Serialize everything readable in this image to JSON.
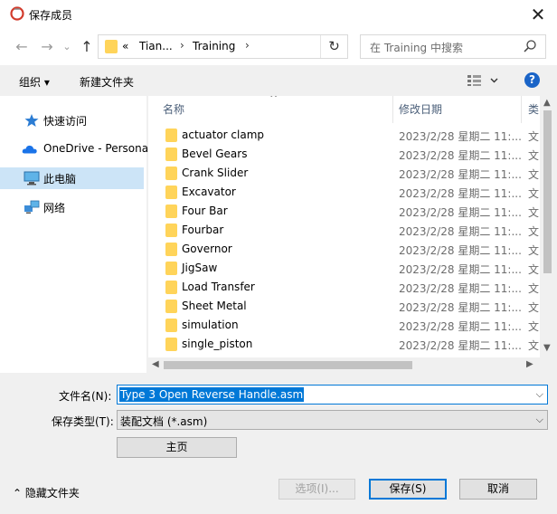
{
  "window": {
    "title": "保存成员"
  },
  "address": {
    "crumbs": [
      "«",
      "Tian...",
      "Training"
    ],
    "refresh_icon": "refresh-icon"
  },
  "search": {
    "placeholder": "在 Training 中搜索"
  },
  "toolbar": {
    "organize": "组织 ▾",
    "new_folder": "新建文件夹",
    "help": "?"
  },
  "sidebar": {
    "items": [
      {
        "label": "快速访问",
        "icon": "star-icon"
      },
      {
        "label": "OneDrive - Personal",
        "icon": "cloud-icon"
      },
      {
        "label": "此电脑",
        "icon": "computer-icon",
        "selected": true
      },
      {
        "label": "网络",
        "icon": "network-icon"
      }
    ]
  },
  "files": {
    "columns": [
      "名称",
      "修改日期",
      "类"
    ],
    "rows": [
      {
        "name": "actuator clamp",
        "date": "2023/2/28 星期二 11:...",
        "type": "文"
      },
      {
        "name": "Bevel Gears",
        "date": "2023/2/28 星期二 11:...",
        "type": "文"
      },
      {
        "name": "Crank Slider",
        "date": "2023/2/28 星期二 11:...",
        "type": "文"
      },
      {
        "name": "Excavator",
        "date": "2023/2/28 星期二 11:...",
        "type": "文"
      },
      {
        "name": "Four Bar",
        "date": "2023/2/28 星期二 11:...",
        "type": "文"
      },
      {
        "name": "Fourbar",
        "date": "2023/2/28 星期二 11:...",
        "type": "文"
      },
      {
        "name": "Governor",
        "date": "2023/2/28 星期二 11:...",
        "type": "文"
      },
      {
        "name": "JigSaw",
        "date": "2023/2/28 星期二 11:...",
        "type": "文"
      },
      {
        "name": "Load Transfer",
        "date": "2023/2/28 星期二 11:...",
        "type": "文"
      },
      {
        "name": "Sheet Metal",
        "date": "2023/2/28 星期二 11:...",
        "type": "文"
      },
      {
        "name": "simulation",
        "date": "2023/2/28 星期二 11:...",
        "type": "文"
      },
      {
        "name": "single_piston",
        "date": "2023/2/28 星期二 11:...",
        "type": "文"
      }
    ]
  },
  "form": {
    "filename_label": "文件名(N):",
    "filename_value": "Type 3 Open Reverse Handle.asm",
    "filetype_label": "保存类型(T):",
    "filetype_value": "装配文档 (*.asm)",
    "home_button": "主页"
  },
  "footer": {
    "hide_folders": "隐藏文件夹",
    "options": "选项(I)...",
    "save": "保存(S)",
    "cancel": "取消"
  }
}
